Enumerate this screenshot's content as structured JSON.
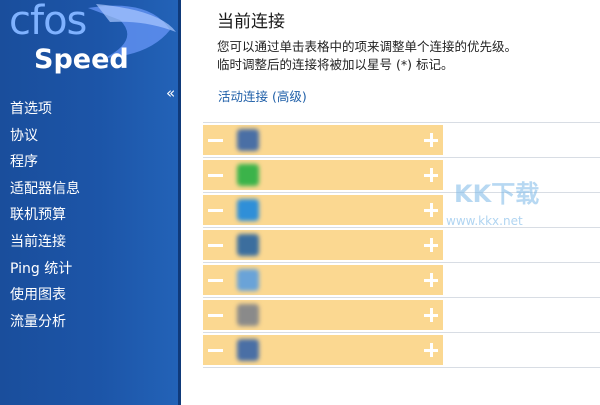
{
  "logo": {
    "line1": "cfos",
    "line2": "Speed"
  },
  "sidebar": {
    "collapse_symbol": "«",
    "items": [
      {
        "label": "首选项"
      },
      {
        "label": "协议"
      },
      {
        "label": "程序"
      },
      {
        "label": "适配器信息"
      },
      {
        "label": "联机预算"
      },
      {
        "label": "当前连接"
      },
      {
        "label": "Ping 统计"
      },
      {
        "label": "使用图表"
      },
      {
        "label": "流量分析"
      }
    ]
  },
  "main": {
    "title": "当前连接",
    "description_line1": "您可以通过单击表格中的项来调整单个连接的优先级。",
    "description_line2": "临时调整后的连接将被加以星号 (*) 标记。",
    "link": "活动连接 (高级)",
    "rows": [
      {
        "icon": "app-icon",
        "icon_color": "#4a6fa5",
        "text": "",
        "sub": ""
      },
      {
        "icon": "app-icon",
        "icon_color": "#3bb34a",
        "text": "",
        "sub": ""
      },
      {
        "icon": "app-icon",
        "icon_color": "#2f8fd8",
        "text": "",
        "sub": ""
      },
      {
        "icon": "app-icon",
        "icon_color": "#3c6e9e",
        "text": "",
        "sub": ""
      },
      {
        "icon": "app-icon",
        "icon_color": "#6aa3d8",
        "text": "",
        "sub": ""
      },
      {
        "icon": "app-icon",
        "icon_color": "#8a8a8a",
        "text": "",
        "sub": ""
      },
      {
        "icon": "app-icon",
        "icon_color": "#4a6fa5",
        "text": "",
        "sub": ""
      }
    ]
  },
  "watermark": {
    "logo": "KK下载",
    "url": "www.kkx.net"
  },
  "colors": {
    "sidebar": "#1c55a8",
    "accent_band": "#fbd891",
    "link": "#1f5fa8"
  }
}
